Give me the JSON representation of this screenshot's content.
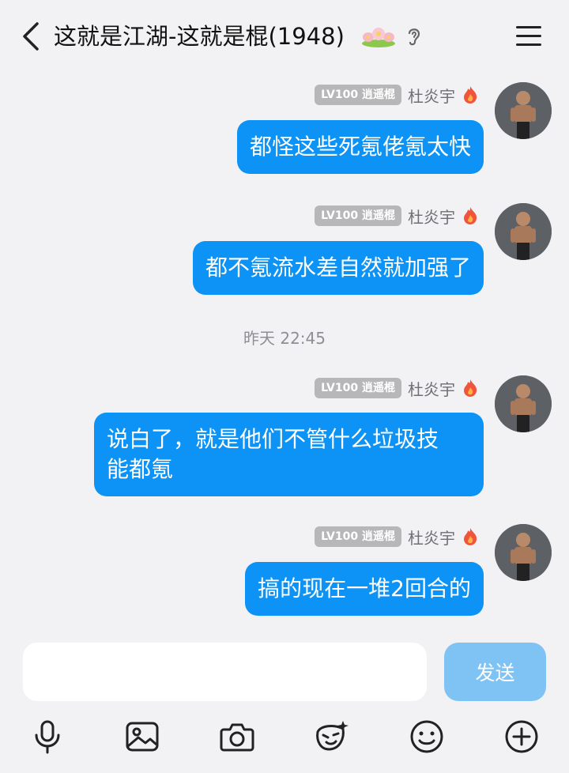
{
  "header": {
    "title": "这就是江湖-这就是棍(1948)",
    "back_icon": "chevron-left-icon",
    "flower_icon": "lotus-flower-icon",
    "ear_icon": "ear-icon",
    "menu_icon": "hamburger-menu-icon"
  },
  "messages": [
    {
      "badge": "LV100 逍遥棍",
      "nickname": "杜炎宇",
      "text": "都怪这些死氪佬氪太快"
    },
    {
      "badge": "LV100 逍遥棍",
      "nickname": "杜炎宇",
      "text": "都不氪流水差自然就加强了"
    },
    {
      "badge": "LV100 逍遥棍",
      "nickname": "杜炎宇",
      "text_line1": "说白了，就是他们不管什么垃圾技",
      "text_line2": "能都氪"
    },
    {
      "badge": "LV100 逍遥棍",
      "nickname": "杜炎宇",
      "text": "搞的现在一堆2回合的"
    }
  ],
  "timestamp": "昨天 22:45",
  "input": {
    "value": "",
    "send_label": "发送"
  },
  "toolbar": [
    "mic-icon",
    "image-icon",
    "camera-icon",
    "sticker-face-icon",
    "emoji-icon",
    "plus-circle-icon"
  ],
  "colors": {
    "bubble": "#0c93f5",
    "send_disabled": "#7fc3f4",
    "badge": "#b7b7b9",
    "background": "#f2f2f4"
  }
}
